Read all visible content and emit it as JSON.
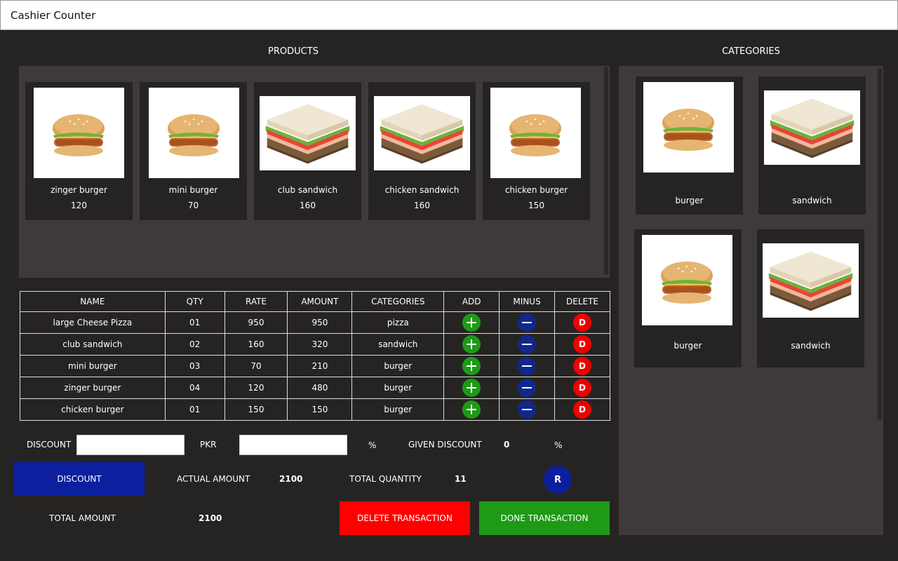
{
  "window": {
    "title": "Cashier Counter"
  },
  "products": {
    "title": "PRODUCTS",
    "items": [
      {
        "name": "zinger burger",
        "price": "120",
        "image": "burger-image"
      },
      {
        "name": "mini burger",
        "price": "70",
        "image": "burger-image"
      },
      {
        "name": "club sandwich",
        "price": "160",
        "image": "sandwich-image"
      },
      {
        "name": "chicken sandwich",
        "price": "160",
        "image": "sandwich-image"
      },
      {
        "name": "chicken burger",
        "price": "150",
        "image": "burger-image"
      }
    ]
  },
  "categories": {
    "title": "CATEGORIES",
    "items": [
      {
        "name": "burger",
        "image": "burger-image"
      },
      {
        "name": "sandwich",
        "image": "sandwich-image"
      },
      {
        "name": "burger",
        "image": "burger-image"
      },
      {
        "name": "sandwich",
        "image": "sandwich-image"
      }
    ]
  },
  "table": {
    "headers": [
      "NAME",
      "QTY",
      "RATE",
      "AMOUNT",
      "CATEGORIES",
      "ADD",
      "MINUS",
      "DELETE"
    ],
    "delete_label": "D",
    "rows": [
      {
        "name": "large Cheese Pizza",
        "qty": "01",
        "rate": "950",
        "amount": "950",
        "category": "pizza"
      },
      {
        "name": "club sandwich",
        "qty": "02",
        "rate": "160",
        "amount": "320",
        "category": "sandwich"
      },
      {
        "name": "mini burger",
        "qty": "03",
        "rate": "70",
        "amount": "210",
        "category": "burger"
      },
      {
        "name": "zinger burger",
        "qty": "04",
        "rate": "120",
        "amount": "480",
        "category": "burger"
      },
      {
        "name": "chicken burger",
        "qty": "01",
        "rate": "150",
        "amount": "150",
        "category": "burger"
      }
    ]
  },
  "discount": {
    "label": "DISCOUNT",
    "pkr_label": "PKR",
    "percent_symbol": "%",
    "given_label": "GIVEN DISCOUNT",
    "given_value": "0",
    "given_percent": "%",
    "pkr_value": "",
    "percent_value": ""
  },
  "summary": {
    "discount_button": "DISCOUNT",
    "actual_amount_label": "ACTUAL AMOUNT",
    "actual_amount_value": "2100",
    "total_quantity_label": "TOTAL QUANTITY",
    "total_quantity_value": "11",
    "reset_button": "R",
    "total_amount_label": "TOTAL AMOUNT",
    "total_amount_value": "2100",
    "delete_transaction": "DELETE TRANSACTION",
    "done_transaction": "DONE TRANSACTION"
  },
  "colors": {
    "background": "#262423",
    "panel": "#3e3a39",
    "add": "#1e9a17",
    "minus": "#10288c",
    "delete": "#f00000",
    "blue_button": "#0c1f9e"
  }
}
